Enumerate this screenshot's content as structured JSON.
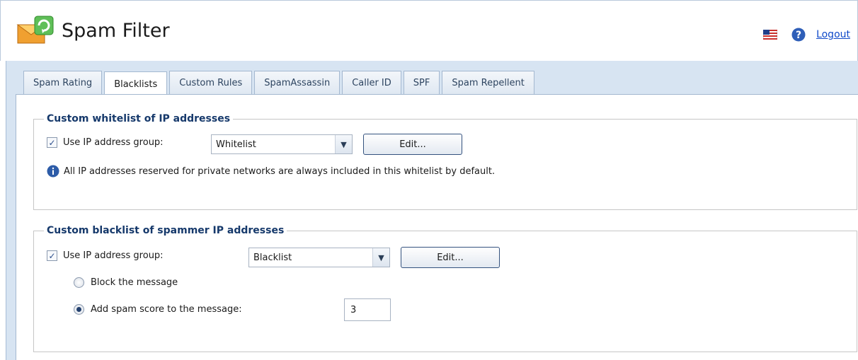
{
  "header": {
    "title": "Spam Filter",
    "logout_label": "Logout",
    "icons": [
      "envelope-refresh-icon",
      "us-flag-icon",
      "help-icon"
    ]
  },
  "tabs": [
    {
      "label": "Spam Rating",
      "active": false
    },
    {
      "label": "Blacklists",
      "active": true
    },
    {
      "label": "Custom Rules",
      "active": false
    },
    {
      "label": "SpamAssassin",
      "active": false
    },
    {
      "label": "Caller ID",
      "active": false
    },
    {
      "label": "SPF",
      "active": false
    },
    {
      "label": "Spam Repellent",
      "active": false
    }
  ],
  "whitelist": {
    "legend": "Custom whitelist of IP addresses",
    "use_group_label": "Use IP address group:",
    "use_group_checked": true,
    "group_value": "Whitelist",
    "edit_label": "Edit...",
    "info_text": "All IP addresses reserved for private networks are always included in this whitelist by default."
  },
  "blacklist": {
    "legend": "Custom blacklist of spammer IP addresses",
    "use_group_label": "Use IP address group:",
    "use_group_checked": true,
    "group_value": "Blacklist",
    "edit_label": "Edit...",
    "block_label": "Block the message",
    "add_score_label": "Add spam score to the message:",
    "selected_option": "add_score",
    "spam_score_value": "3"
  },
  "colors": {
    "main_bg": "#d7e4f2",
    "legend_text": "#16396b",
    "link": "#0f49c9"
  }
}
